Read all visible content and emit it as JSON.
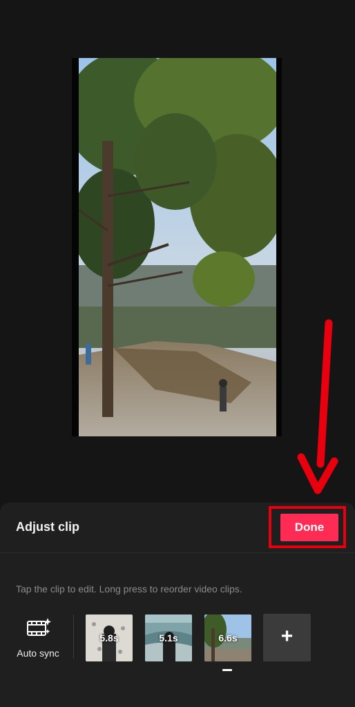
{
  "panel": {
    "title": "Adjust clip",
    "done_label": "Done",
    "hint": "Tap the clip to edit. Long press to reorder video clips."
  },
  "autosync": {
    "label": "Auto sync",
    "icon": "film-sparkle-icon"
  },
  "clips": [
    {
      "duration": "5.8s"
    },
    {
      "duration": "5.1s"
    },
    {
      "duration": "6.6s"
    }
  ],
  "add_clip": {
    "label": "+",
    "icon": "plus-icon"
  },
  "annotation": {
    "icon": "red-arrow-icon",
    "color": "#e8000f"
  },
  "colors": {
    "accent": "#fe2c55",
    "background": "#151515",
    "panel": "#1f1f1f"
  }
}
